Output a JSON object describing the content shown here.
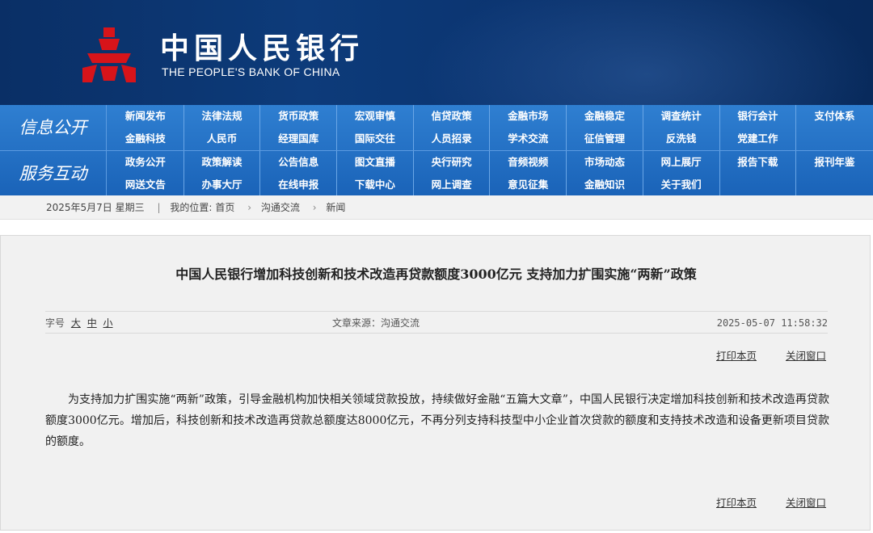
{
  "header": {
    "logo_cn": "中国人民银行",
    "logo_en": "THE PEOPLE'S BANK OF CHINA",
    "logo_color": "#d7141a"
  },
  "nav": {
    "section1": {
      "title": "信息公开",
      "row1": [
        "新闻发布",
        "法律法规",
        "货币政策",
        "宏观审慎",
        "信贷政策",
        "金融市场",
        "金融稳定",
        "调查统计",
        "银行会计",
        "支付体系"
      ],
      "row2": [
        "金融科技",
        "人民币",
        "经理国库",
        "国际交往",
        "人员招录",
        "学术交流",
        "征信管理",
        "反洗钱",
        "党建工作",
        ""
      ]
    },
    "section2": {
      "title": "服务互动",
      "row1": [
        "政务公开",
        "政策解读",
        "公告信息",
        "图文直播",
        "央行研究",
        "音频视频",
        "市场动态",
        "网上展厅",
        "报告下载",
        "报刊年鉴"
      ],
      "row2": [
        "网送文告",
        "办事大厅",
        "在线申报",
        "下载中心",
        "网上调查",
        "意见征集",
        "金融知识",
        "关于我们",
        "",
        ""
      ]
    }
  },
  "breadcrumb": {
    "date": "2025年5月7日 星期三",
    "label": "我的位置:",
    "items": [
      "首页",
      "沟通交流",
      "新闻"
    ]
  },
  "article": {
    "title": "中国人民银行增加科技创新和技术改造再贷款额度3000亿元 支持加力扩围实施“两新”政策",
    "font_size_label": "字号",
    "font_sizes": [
      "大",
      "中",
      "小"
    ],
    "source": "文章来源：沟通交流",
    "datetime": "2025-05-07 11:58:32",
    "print_label": "打印本页",
    "close_label": "关闭窗口",
    "body": "为支持加力扩围实施“两新”政策，引导金融机构加快相关领域贷款投放，持续做好金融“五篇大文章”，中国人民银行决定增加科技创新和技术改造再贷款额度3000亿元。增加后，科技创新和技术改造再贷款总额度达8000亿元，不再分列支持科技型中小企业首次贷款的额度和支持技术改造和设备更新项目贷款的额度。"
  }
}
